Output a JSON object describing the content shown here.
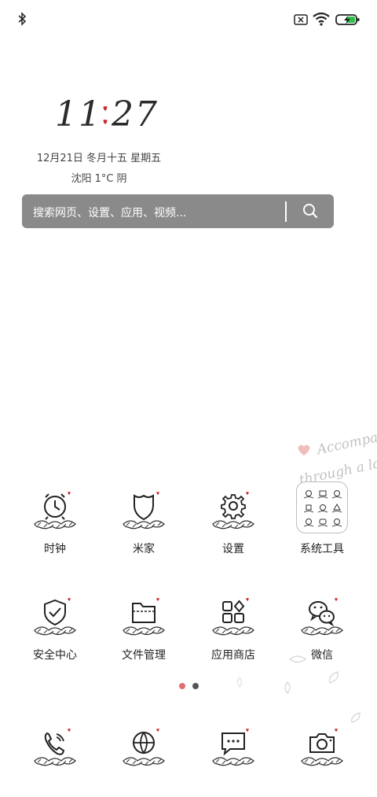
{
  "status_bar": {
    "left_icons": [
      "bluetooth-icon"
    ],
    "right_icons": [
      "no-sim-icon",
      "wifi-icon",
      "battery-charging-icon"
    ]
  },
  "clock_widget": {
    "hours": "11",
    "minutes": "27",
    "date": "12月21日 冬月十五 星期五",
    "weather": "沈阳 1°C 阴"
  },
  "search": {
    "placeholder": "搜索网页、设置、应用、视频..."
  },
  "wallpaper": {
    "text_line1": "Accompany",
    "text_line2": "through a lo"
  },
  "apps_row1": [
    {
      "label": "时钟",
      "icon": "alarm-clock-icon"
    },
    {
      "label": "米家",
      "icon": "shield-icon"
    },
    {
      "label": "设置",
      "icon": "gear-icon"
    },
    {
      "label": "系统工具",
      "icon": "folder-icon"
    }
  ],
  "apps_row2": [
    {
      "label": "安全中心",
      "icon": "security-check-icon"
    },
    {
      "label": "文件管理",
      "icon": "file-folder-icon"
    },
    {
      "label": "应用商店",
      "icon": "app-store-icon"
    },
    {
      "label": "微信",
      "icon": "wechat-icon"
    }
  ],
  "dock": [
    {
      "icon": "phone-icon"
    },
    {
      "icon": "browser-globe-icon"
    },
    {
      "icon": "message-icon"
    },
    {
      "icon": "camera-icon"
    }
  ],
  "page_indicator": {
    "current": 1,
    "total": 2
  },
  "colors": {
    "heart": "#c8282e",
    "accent_dot": "#e07070",
    "text": "#222222",
    "search_bg": "#8a8a8a"
  }
}
